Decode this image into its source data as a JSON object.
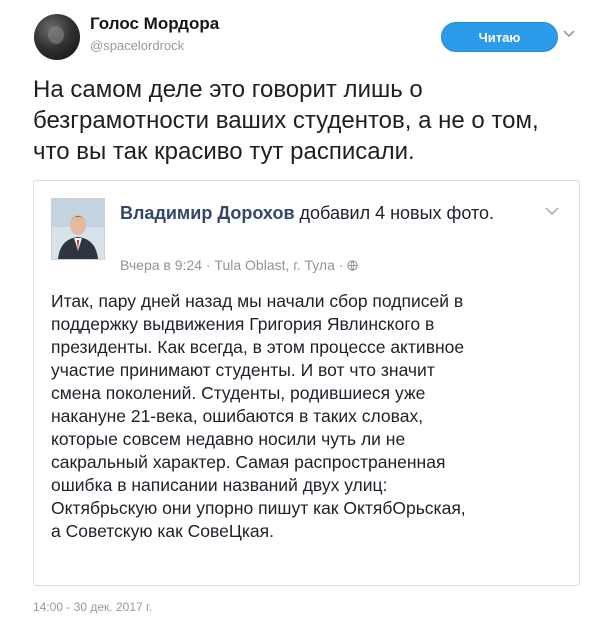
{
  "tweet": {
    "author_name": "Голос Мордора",
    "author_handle": "@spacelordrock",
    "follow_label": "Читаю",
    "text": "На самом деле это говорит лишь о безграмотности ваших студентов, а не о том, что вы так красиво тут расписали.",
    "timestamp": "14:00 - 30 дек. 2017 г."
  },
  "quoted_post": {
    "author": "Владимир Дорохов",
    "action": "добавил 4 новых фото.",
    "meta": "Вчера в 9:24 · Tula Oblast, г. Тула ·",
    "body_lines": [
      "Итак, пару дней назад мы начали сбор подписей в",
      "поддержку выдвижения Григория Явлинского в",
      "президенты. Как всегда, в этом процессе активное",
      "участие принимают студенты. И вот что значит",
      "смена поколений. Студенты, родившиеся уже",
      "накануне 21-века, ошибаются в таких словах,",
      "которые совсем недавно носили чуть ли не",
      "сакральный характер. Самая распространенная",
      "ошибка в написании названий двух улиц:",
      "Октябрьскую они упорно пишут как ОктябОрьская,",
      "а Советскую как СовеЦкая."
    ]
  },
  "colors": {
    "follow_button": "#2c9bea",
    "fb_author_name": "#36466b",
    "muted_text": "#8f9ba5"
  },
  "icons": [
    "avatar",
    "chevron-down-icon",
    "globe-icon",
    "profile-photo"
  ]
}
